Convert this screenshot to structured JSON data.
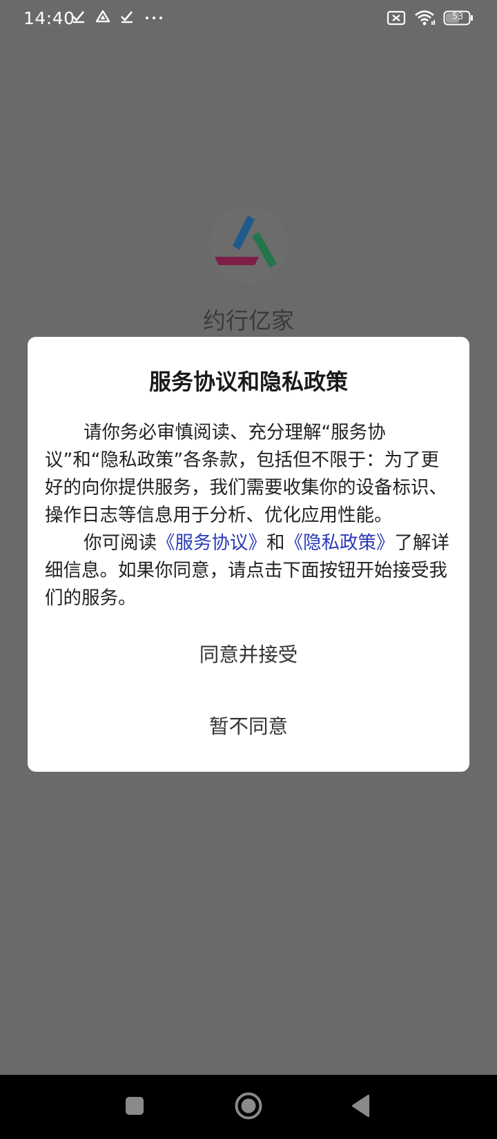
{
  "status_bar": {
    "time": "14:40",
    "battery": "53",
    "icons_left": [
      "check-download-icon",
      "drive-icon",
      "check-download-icon",
      "more-dots-icon"
    ],
    "icons_right": [
      "no-sim-icon",
      "wifi-icon",
      "battery-icon"
    ]
  },
  "app": {
    "name": "约行亿家",
    "logo_colors": {
      "blue": "#1f6fb0",
      "green": "#2a9a5a",
      "magenta": "#a8275e"
    }
  },
  "dialog": {
    "title": "服务协议和隐私政策",
    "para1": "请你务必审慎阅读、充分理解“服务协议”和“隐私政策”各条款，包括但不限于：为了更好的向你提供服务，我们需要收集你的设备标识、操作日志等信息用于分析、优化应用性能。",
    "para2_prefix": "你可阅读",
    "link_service": "《服务协议》",
    "para2_and": "和",
    "link_privacy": "《隐私政策》",
    "para2_suffix": "了解详细信息。如果你同意，请点击下面按钮开始接受我们的服务。",
    "accept_label": "同意并接受",
    "decline_label": "暂不同意"
  },
  "nav_bar": {
    "buttons": [
      "recents-square-icon",
      "home-circle-icon",
      "back-triangle-icon"
    ]
  },
  "colors": {
    "scrim": "#6a6a6a",
    "dialog_bg": "#ffffff",
    "link": "#2a39b8",
    "nav_bg": "#000000"
  }
}
